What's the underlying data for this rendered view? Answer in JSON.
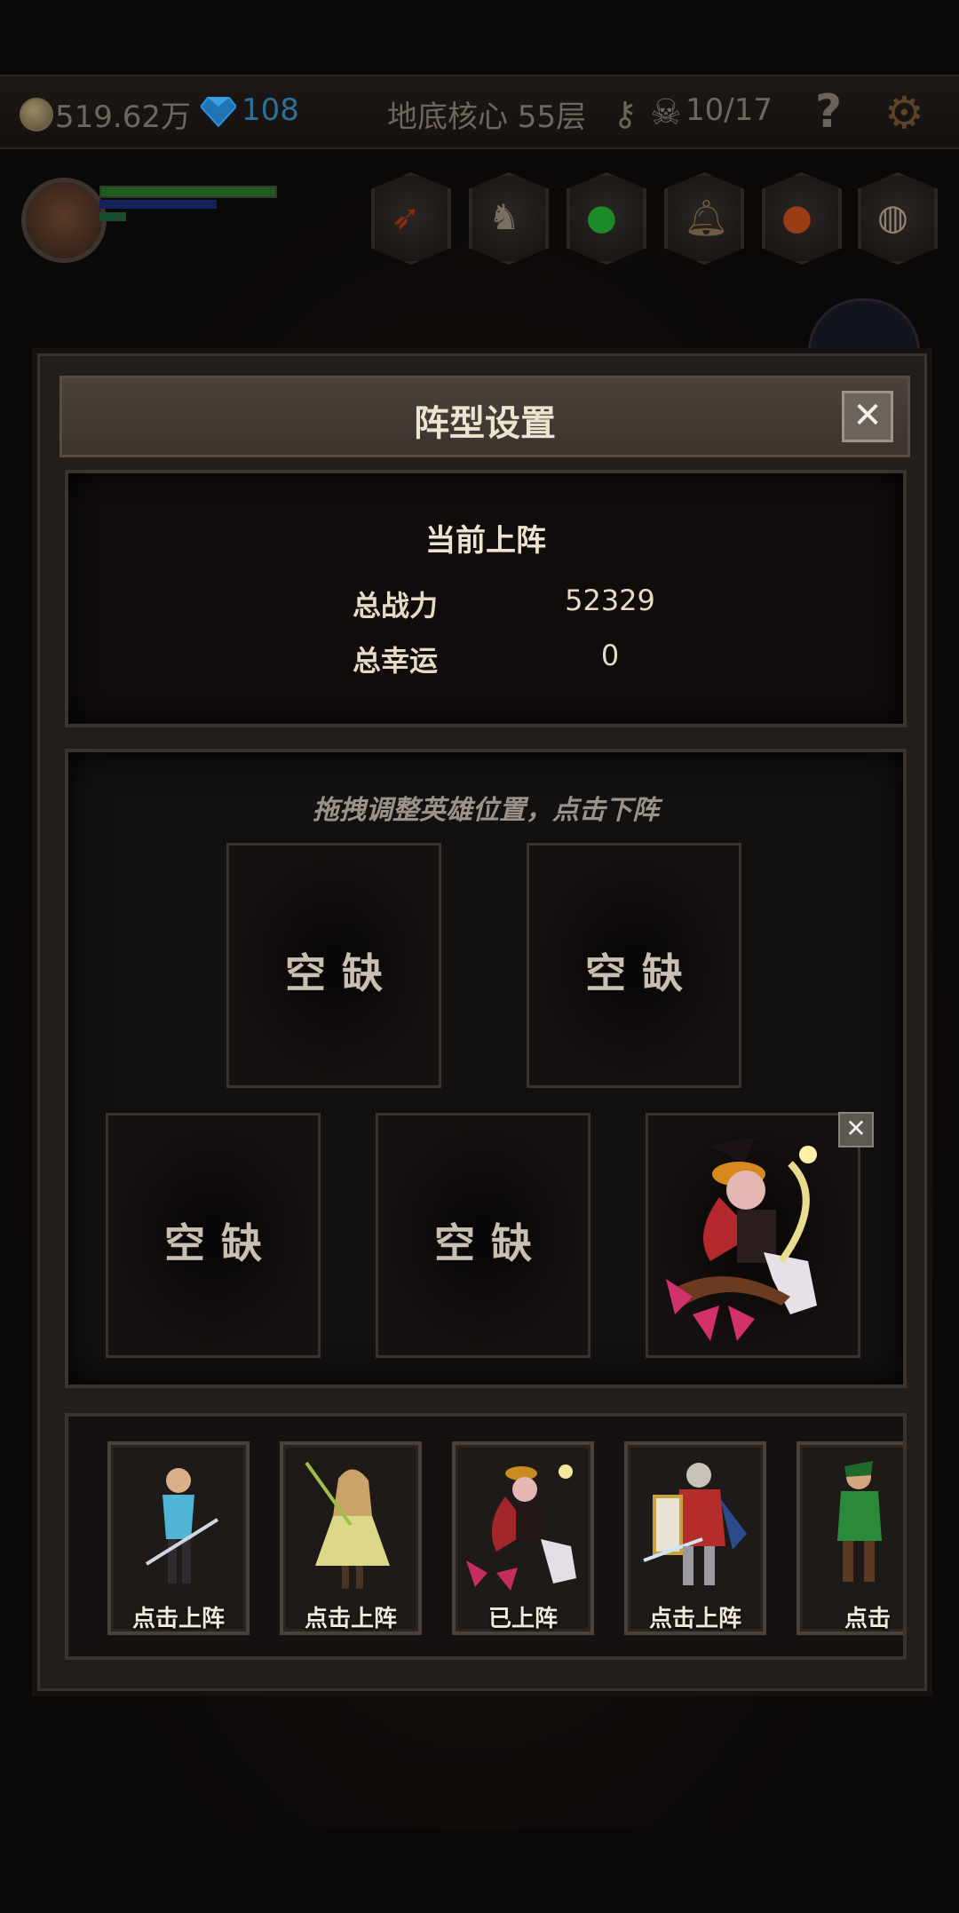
{
  "topbar": {
    "gold": "519.62万",
    "gems": "108",
    "location": "地底核心 55层",
    "skulls": "10/17",
    "help_label": "?"
  },
  "icons": {
    "gold": "coin-icon",
    "gems": "diamond-icon",
    "key": "key-icon",
    "skull": "skull-icon",
    "help": "question-icon",
    "settings": "gear-icon"
  },
  "skills": [
    "carrot-icon",
    "horse-head-icon",
    "green-orb-icon",
    "bell-icon",
    "fire-orb-icon",
    "bread-icon"
  ],
  "modal": {
    "title": "阵型设置",
    "close_label": "✕"
  },
  "summary": {
    "heading": "当前上阵",
    "power_label": "总战力",
    "power_value": "52329",
    "luck_label": "总幸运",
    "luck_value": "0"
  },
  "formation": {
    "hint": "拖拽调整英雄位置，点击下阵",
    "slots": [
      {
        "label": "空缺"
      },
      {
        "label": "空缺"
      },
      {
        "label": "空缺"
      },
      {
        "label": "空缺"
      },
      {
        "label": "",
        "hero": "witch-hero"
      }
    ],
    "remove_label": "✕"
  },
  "roster": [
    {
      "hero": "swordsman",
      "label": "点击上阵"
    },
    {
      "hero": "priestess",
      "label": "点击上阵"
    },
    {
      "hero": "witch",
      "label": "已上阵"
    },
    {
      "hero": "paladin",
      "label": "点击上阵"
    },
    {
      "hero": "ranger",
      "label": "点击"
    }
  ],
  "colors": {
    "accent_gold": "#d8b35a",
    "gem_blue": "#3aa0e8",
    "panel": "#231e1a"
  }
}
